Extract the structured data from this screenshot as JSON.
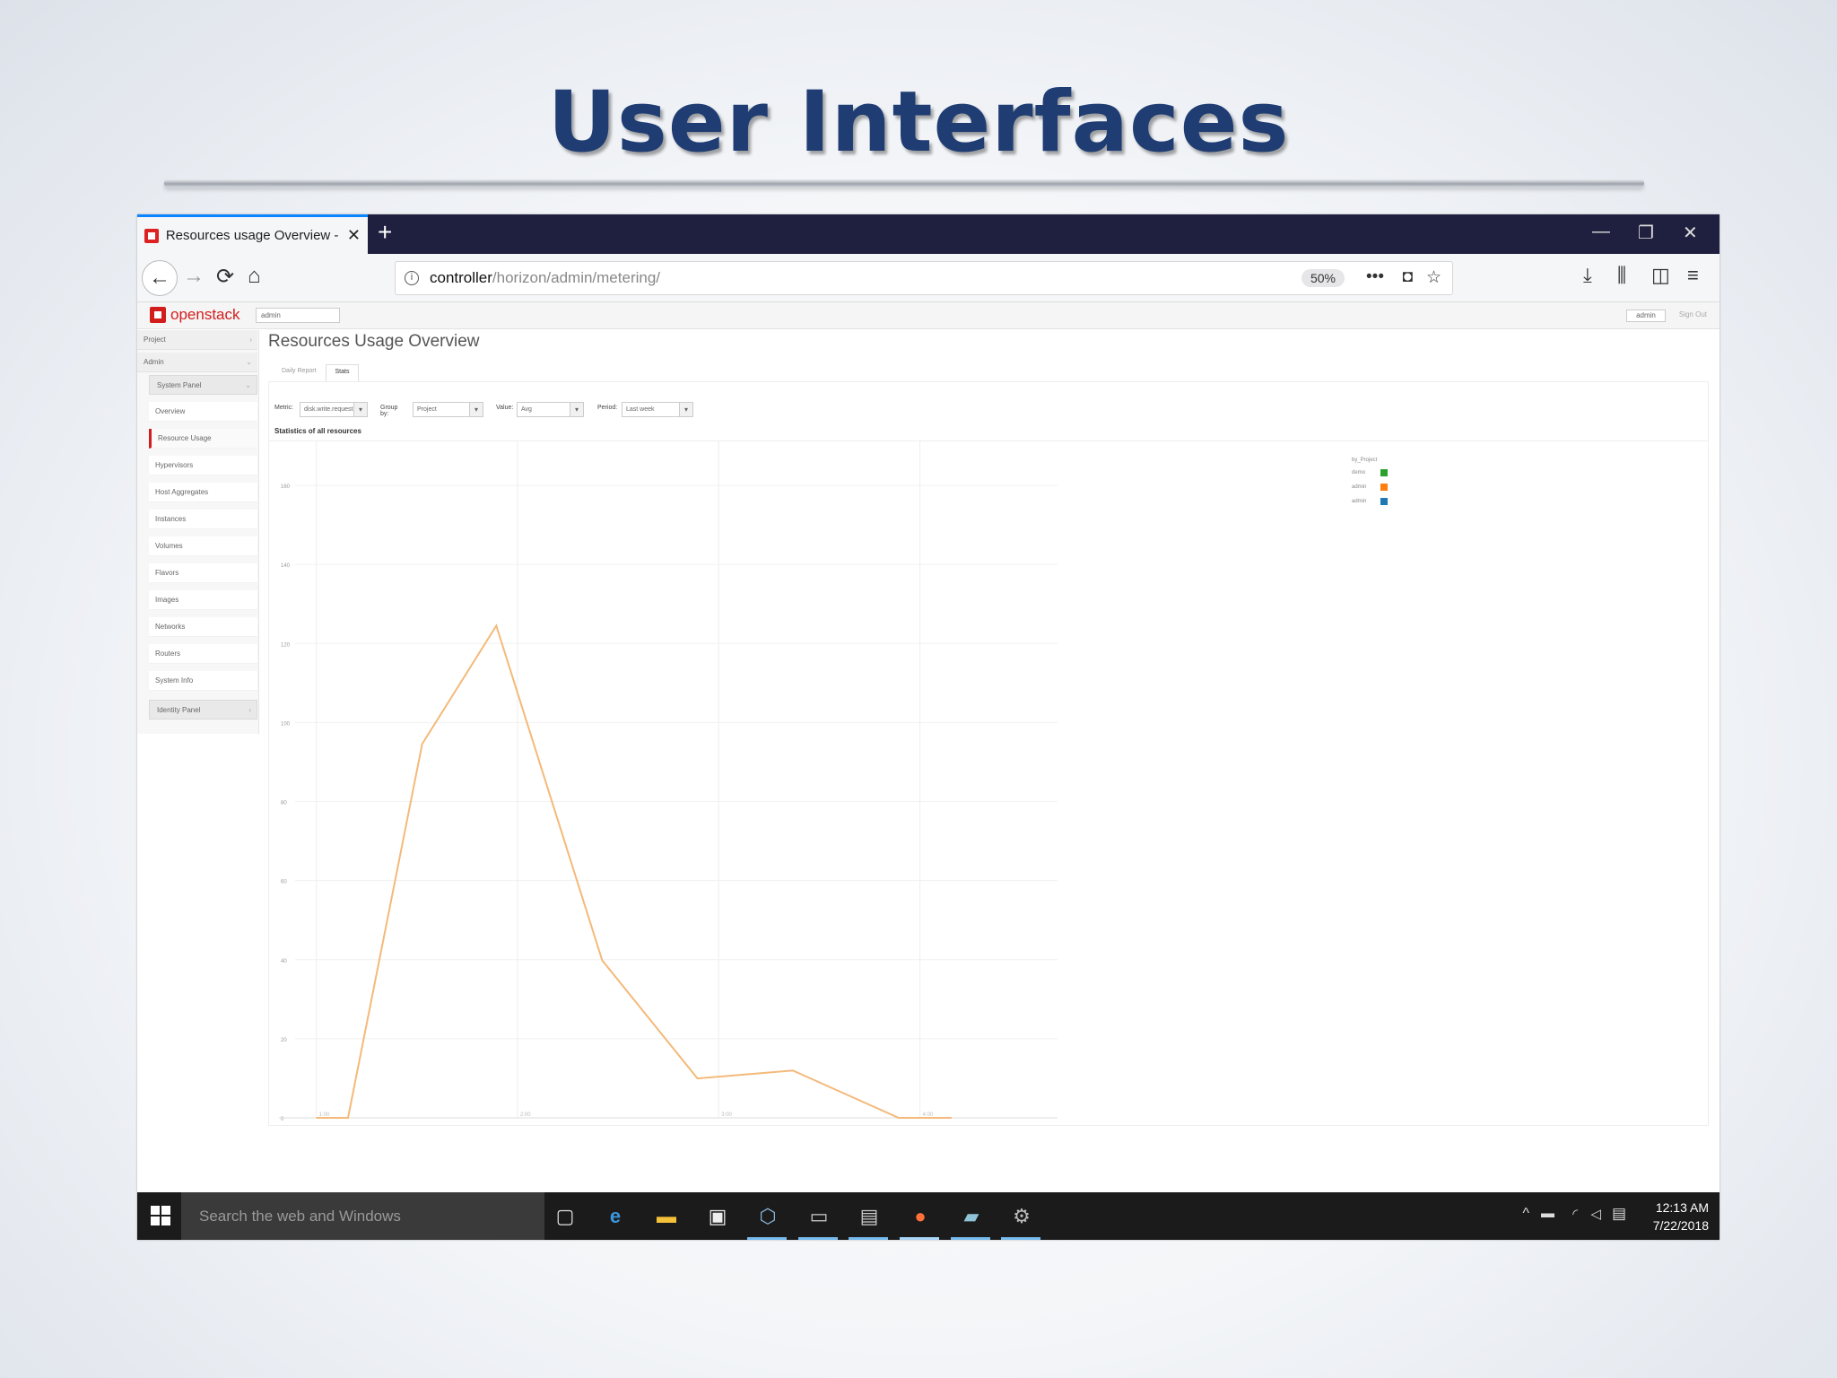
{
  "slide": {
    "title": "User Interfaces"
  },
  "browser": {
    "tab_title": "Resources usage Overview - O",
    "url_host": "controller",
    "url_path": "/horizon/admin/metering/",
    "zoom": "50%"
  },
  "openstack": {
    "logo_text": "openstack",
    "project": "admin",
    "user": "admin",
    "sign_out": "Sign Out"
  },
  "sidebar": {
    "top": [
      {
        "label": "Project"
      },
      {
        "label": "Admin"
      }
    ],
    "system_panel": "System Panel",
    "items": [
      {
        "label": "Overview"
      },
      {
        "label": "Resource Usage"
      },
      {
        "label": "Hypervisors"
      },
      {
        "label": "Host Aggregates"
      },
      {
        "label": "Instances"
      },
      {
        "label": "Volumes"
      },
      {
        "label": "Flavors"
      },
      {
        "label": "Images"
      },
      {
        "label": "Networks"
      },
      {
        "label": "Routers"
      },
      {
        "label": "System Info"
      }
    ],
    "identity_panel": "Identity Panel"
  },
  "page": {
    "title": "Resources Usage Overview",
    "tabs": [
      {
        "label": "Daily Report"
      },
      {
        "label": "Stats"
      }
    ],
    "filters": {
      "metric_label": "Metric:",
      "metric_value": "disk.write.request",
      "group_label": "Group by:",
      "group_value": "Project",
      "value_label": "Value:",
      "value_value": "Avg",
      "period_label": "Period:",
      "period_value": "Last week"
    },
    "stats_title": "Statistics of all resources"
  },
  "chart_data": {
    "type": "line",
    "y_ticks": [
      "160",
      "140",
      "120",
      "100",
      "80",
      "60",
      "40",
      "20",
      "0"
    ],
    "x_ticks": [
      "1:00",
      "2:00",
      "3:00",
      "4:00"
    ],
    "legend_title": "by_Project",
    "legend": [
      {
        "name": "demo",
        "color": "#2ca02c"
      },
      {
        "name": "admin",
        "color": "#ff7f0e"
      },
      {
        "name": "admin",
        "color": "#1f77b4"
      }
    ],
    "series": [
      {
        "color": "#f4b97a",
        "points": [
          [
            0.1,
            0
          ],
          [
            0.25,
            0
          ],
          [
            0.6,
            95
          ],
          [
            0.95,
            125
          ],
          [
            1.45,
            40
          ],
          [
            1.9,
            10
          ],
          [
            2.35,
            12
          ],
          [
            2.85,
            0
          ],
          [
            3.1,
            0
          ]
        ]
      }
    ],
    "xlim": [
      0,
      3.6
    ],
    "ylim": [
      0,
      165
    ]
  },
  "taskbar": {
    "search_placeholder": "Search the web and Windows",
    "time": "12:13 AM",
    "date": "7/22/2018"
  }
}
